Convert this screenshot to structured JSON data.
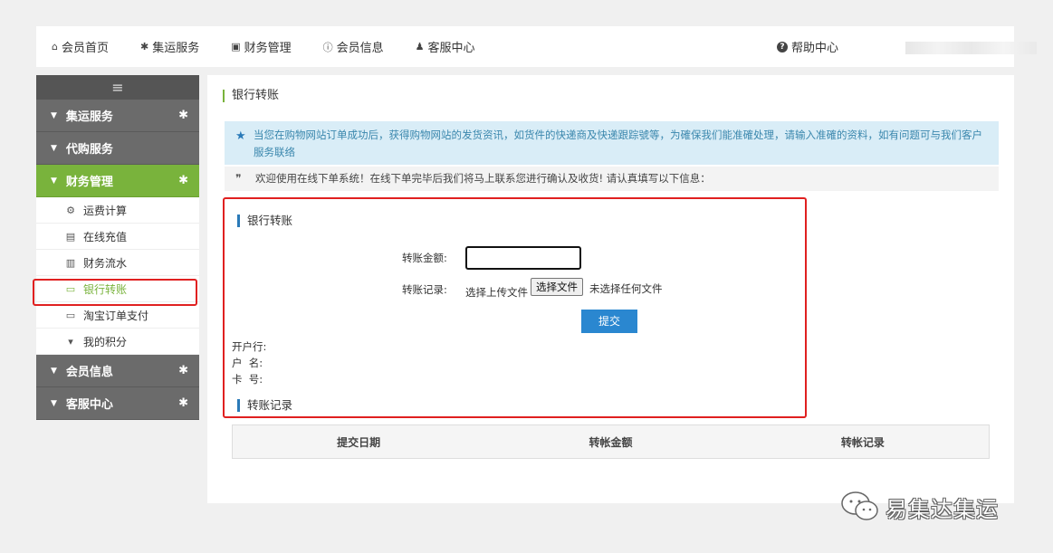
{
  "topnav": {
    "items": [
      {
        "icon": "home-icon",
        "glyph": "⌂",
        "label": "会员首页"
      },
      {
        "icon": "gear-icon",
        "glyph": "✱",
        "label": "集运服务"
      },
      {
        "icon": "money-icon",
        "glyph": "▣",
        "label": "财务管理"
      },
      {
        "icon": "info-icon",
        "glyph": "ⓘ",
        "label": "会员信息"
      },
      {
        "icon": "user-icon",
        "glyph": "♟",
        "label": "客服中心"
      }
    ],
    "help": {
      "icon": "question-icon",
      "glyph": "?",
      "label": "帮助中心"
    }
  },
  "sidebar": {
    "toggle": "≡",
    "sections": [
      {
        "label": "集运服务",
        "gear": true
      },
      {
        "label": "代购服务",
        "gear": false
      },
      {
        "label": "财务管理",
        "gear": true,
        "active": true,
        "items": [
          {
            "icon": "cogs-icon",
            "glyph": "⚙",
            "label": "运费计算"
          },
          {
            "icon": "card-icon",
            "glyph": "▤",
            "label": "在线充值"
          },
          {
            "icon": "chart-icon",
            "glyph": "▥",
            "label": "财务流水"
          },
          {
            "icon": "credit-card-icon",
            "glyph": "▭",
            "label": "银行转账",
            "current": true
          },
          {
            "icon": "credit-card-icon",
            "glyph": "▭",
            "label": "淘宝订单支付"
          },
          {
            "icon": "gift-icon",
            "glyph": "▾",
            "label": "我的积分"
          }
        ]
      },
      {
        "label": "会员信息",
        "gear": true
      },
      {
        "label": "客服中心",
        "gear": true
      }
    ]
  },
  "main": {
    "title": "银行转账",
    "notice": "当您在购物网站订单成功后，获得购物网站的发货资讯，如货件的快递商及快递跟踪號等，为確保我们能准確处理，请输入准確的资料，如有问题可与我们客户服务联络",
    "welcome": "欢迎使用在线下单系统！在线下单完毕后我们将马上联系您进行确认及收货! 请认真填写以下信息：",
    "form": {
      "title": "银行转账",
      "amount_label": "转账金额:",
      "amount_value": "",
      "record_label": "转账记录:",
      "upload_hint": "选择上传文件",
      "file_button": "选择文件",
      "file_status": "未选择任何文件",
      "submit": "提交",
      "bank_label": "开户行:",
      "name_label": "户  名:",
      "card_label": "卡  号:",
      "records_title": "转账记录"
    },
    "table": {
      "headers": [
        "提交日期",
        "转帐金额",
        "转帐记录"
      ]
    }
  },
  "watermark": "易集达集运"
}
